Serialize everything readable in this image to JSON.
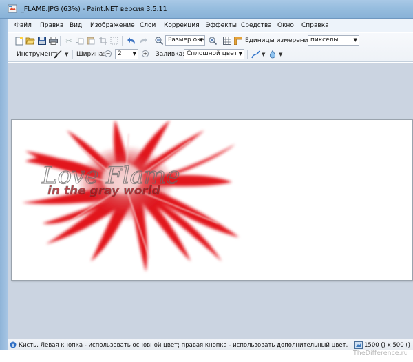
{
  "window": {
    "title": "_FLAME.JPG (63%) - Paint.NET версия 3.5.11"
  },
  "menu": {
    "items": [
      "Файл",
      "Правка",
      "Вид",
      "Изображение",
      "Слои",
      "Коррекция",
      "Эффекты",
      "Средства",
      "Окно",
      "Справка"
    ]
  },
  "toolbar": {
    "zoom_value": "Размер окна",
    "units_label": "Единицы измерения:",
    "units_value": "пикселы",
    "tool_label": "Инструмент:",
    "width_label": "Ширина:",
    "width_value": "2",
    "fill_label": "Заливка:",
    "fill_value": "Сплошной цвет"
  },
  "canvas": {
    "text_line1": "Love Flame",
    "text_line2": "in the gray world",
    "flame_color": "#e2131b"
  },
  "status": {
    "hint": "Кисть. Левая кнопка - использовать основной цвет; правая кнопка - использовать дополнительный цвет.",
    "image_size": "1500 () x 500 ()"
  },
  "watermark": {
    "text": "TheDifference.ru"
  },
  "icons": [
    "paintnet-app-icon",
    "new-file-icon",
    "open-file-icon",
    "save-icon",
    "print-icon",
    "cut-icon",
    "copy-icon",
    "paste-icon",
    "crop-icon",
    "deselect-icon",
    "undo-icon",
    "redo-icon",
    "zoom-out-icon",
    "zoom-in-icon",
    "grid-icon",
    "ruler-icon",
    "brush-icon",
    "minus-icon",
    "plus-icon",
    "antialias-icon",
    "blend-mode-icon",
    "image-size-icon"
  ]
}
